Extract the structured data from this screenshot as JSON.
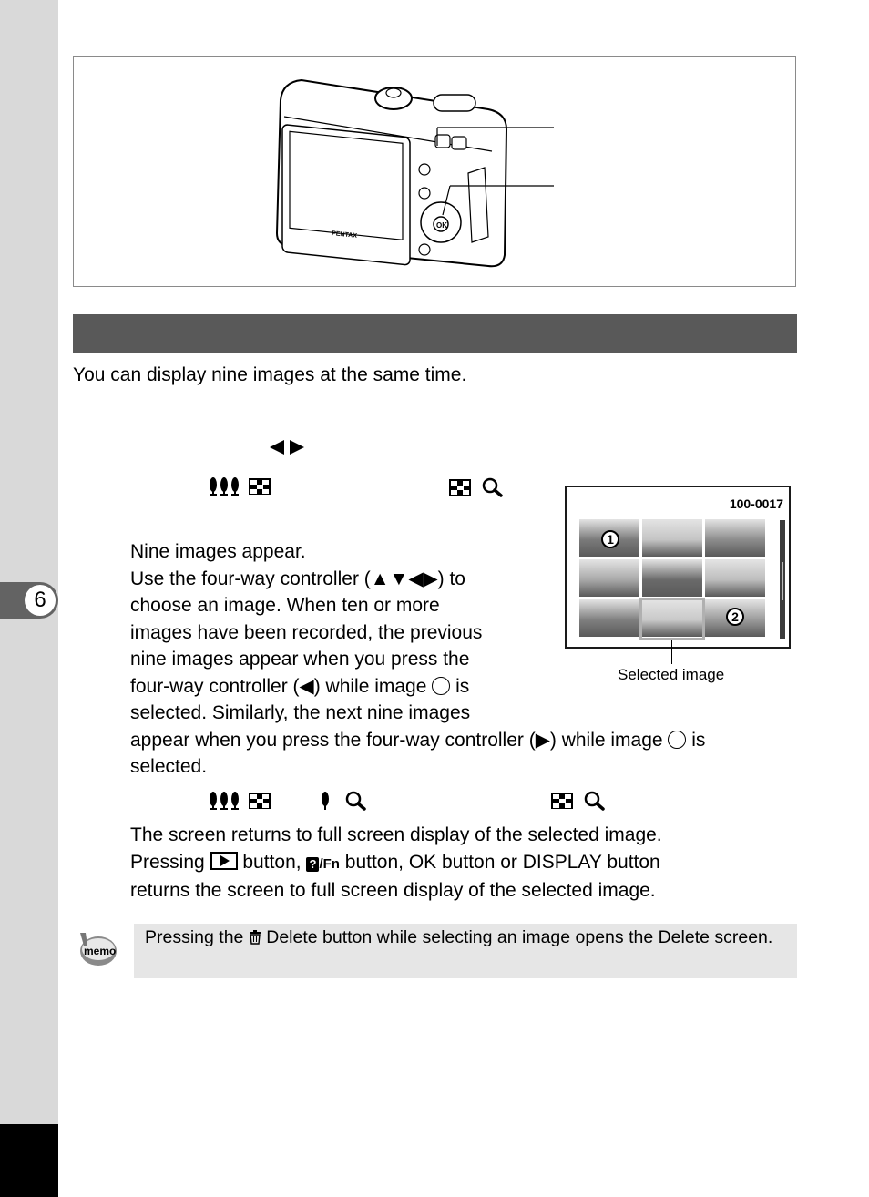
{
  "chapter": {
    "number": "6"
  },
  "figure": {
    "camera_brand": "PENTAX",
    "ok_label": "OK"
  },
  "intro": "You can display nine images at the same time.",
  "steps": {
    "step2_text_lines": [
      "Nine images appear.",
      "Use the four-way controller (▲▼◀▶) to",
      "choose an image. When ten or more",
      "images have been recorded, the previous",
      "nine images appear when you press the"
    ],
    "line_prev_a": "four-way controller (◀) while image ",
    "line_prev_b": " is",
    "line_similarly": "selected. Similarly, the next nine images",
    "line_next_a": "appear when you press the four-way controller (▶) while image ",
    "line_next_b": " is",
    "line_selected": "selected.",
    "step3_line1": "The screen returns to full screen display of the selected image.",
    "step3_line2a": "Pressing ",
    "step3_line2b": " button, ",
    "step3_line2c": " button, OK button or DISPLAY button",
    "fn_label": "/Fn",
    "fn_q": "?",
    "step3_line3": "returns the screen to full screen display of the selected image."
  },
  "screen_display": {
    "file_number": "100-0017",
    "badge1": "1",
    "badge2": "2",
    "caption": "Selected image",
    "thumbnails": 9,
    "selected_index": 7
  },
  "memo": {
    "icon_label": "memo",
    "text_a": "Pressing the ",
    "trash_glyph": "Ὕ1",
    "text_b": " Delete button while selecting an image opens the Delete screen."
  },
  "icons": {
    "nav_arrows": [
      "left-triangle",
      "right-triangle"
    ],
    "thumbnail_mode": "three-trees-icon",
    "grid": "nine-grid-icon",
    "zoom": "magnifier-icon",
    "single": "single-tree-icon"
  }
}
